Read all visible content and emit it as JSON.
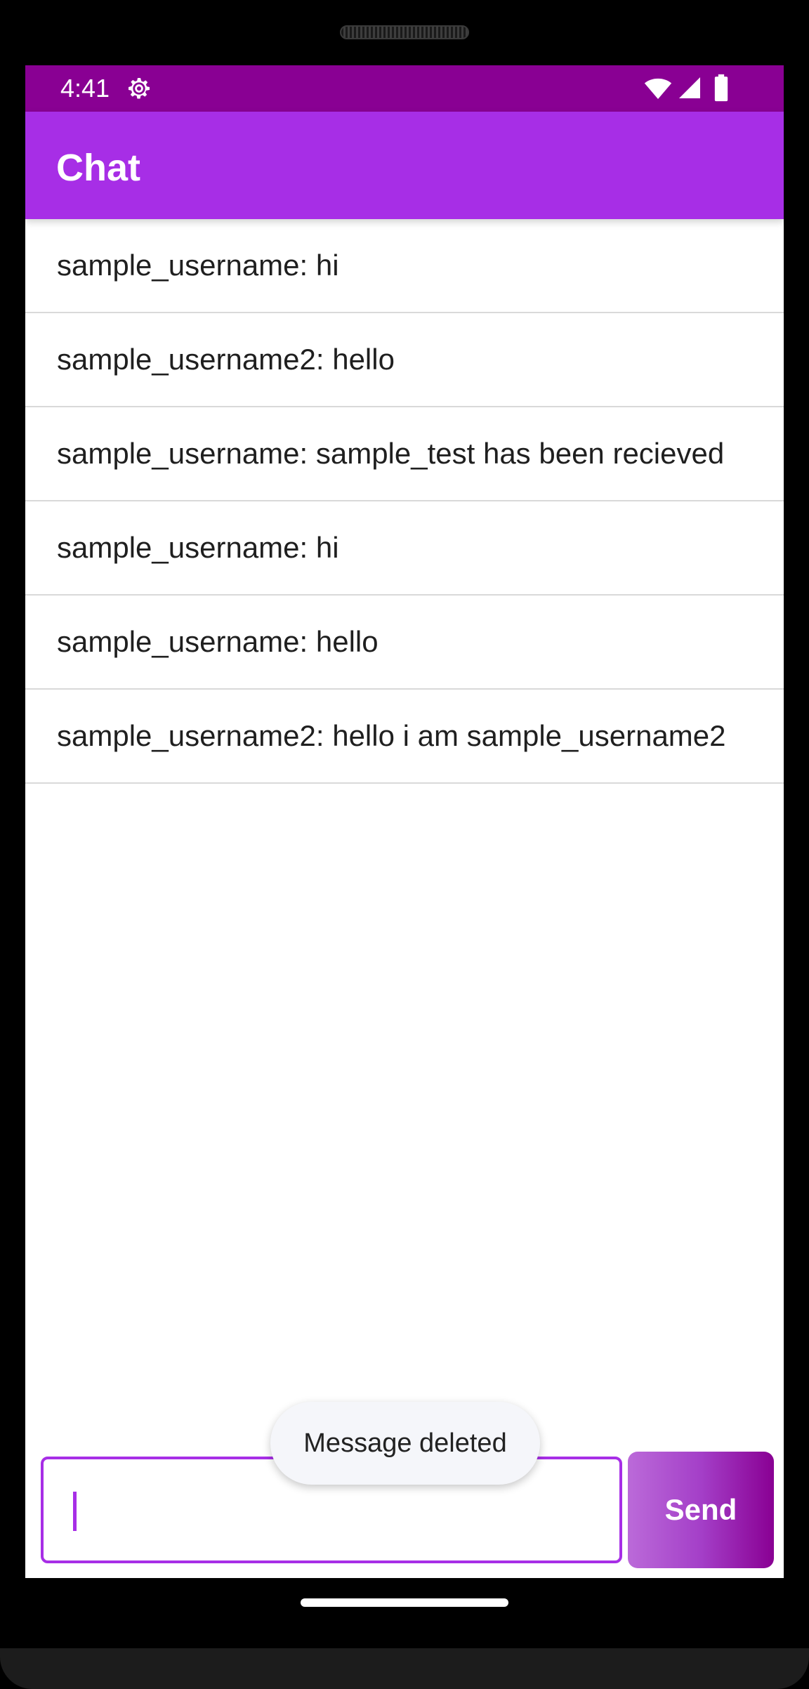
{
  "status_bar": {
    "time": "4:41",
    "icons": [
      "settings-gear-icon",
      "wifi-icon",
      "cell-signal-icon",
      "battery-icon"
    ]
  },
  "app_bar": {
    "title": "Chat"
  },
  "messages": [
    {
      "text": "sample_username: hi"
    },
    {
      "text": "sample_username2: hello"
    },
    {
      "text": "sample_username: sample_test has been recieved"
    },
    {
      "text": "sample_username: hi"
    },
    {
      "text": "sample_username: hello"
    },
    {
      "text": "sample_username2: hello i am sample_username2"
    }
  ],
  "composer": {
    "input_value": "",
    "send_label": "Send"
  },
  "toast": {
    "text": "Message deleted"
  },
  "colors": {
    "status_bar": "#890093",
    "app_bar": "#a72ee6",
    "accent": "#a72ee6"
  }
}
